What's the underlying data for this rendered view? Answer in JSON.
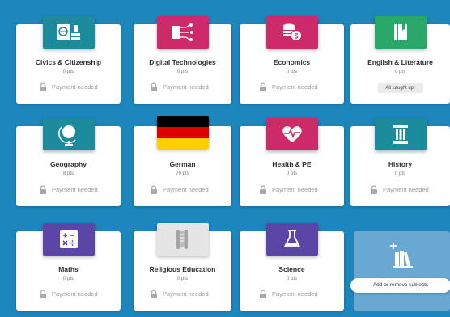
{
  "subjects": [
    {
      "name": "Civics & Citizenship",
      "pts": "0 pts",
      "status": "Payment needed",
      "icon": "passport-icon",
      "color": "#1c8b9c"
    },
    {
      "name": "Digital Technologies",
      "pts": "0 pts",
      "status": "Payment needed",
      "icon": "circuit-icon",
      "color": "#cc2a69"
    },
    {
      "name": "Economics",
      "pts": "0 pts",
      "status": "Payment needed",
      "icon": "coins-icon",
      "color": "#cc2a69"
    },
    {
      "name": "English & Literature",
      "pts": "0 pts",
      "status": "All caught up!",
      "icon": "book-icon",
      "color": "#2aa86a"
    },
    {
      "name": "Geography",
      "pts": "8 pts",
      "status": "Payment needed",
      "icon": "globe-icon",
      "color": "#1c8b9c"
    },
    {
      "name": "German",
      "pts": "70 pts",
      "status": "Payment needed",
      "icon": "german-flag-icon",
      "color": "#000000"
    },
    {
      "name": "Health & PE",
      "pts": "0 pts",
      "status": "Payment needed",
      "icon": "heartbeat-icon",
      "color": "#cc2a69"
    },
    {
      "name": "History",
      "pts": "0 pts",
      "status": "Payment needed",
      "icon": "column-icon",
      "color": "#1c8b9c"
    },
    {
      "name": "Maths",
      "pts": "0 pts",
      "status": "Payment needed",
      "icon": "calculator-icon",
      "color": "#5b45a6"
    },
    {
      "name": "Religious Education",
      "pts": "0 pts",
      "status": "Payment needed",
      "icon": "scroll-icon",
      "color": "#e5e5e5"
    },
    {
      "name": "Science",
      "pts": "0 pts",
      "status": "Payment needed",
      "icon": "flask-icon",
      "color": "#5b45a6"
    }
  ],
  "add_subjects": {
    "label": "Add or remove subjects",
    "icon": "add-books-icon"
  },
  "colors": {
    "background": "#1d86bd",
    "add_card": "#68a8d3"
  }
}
